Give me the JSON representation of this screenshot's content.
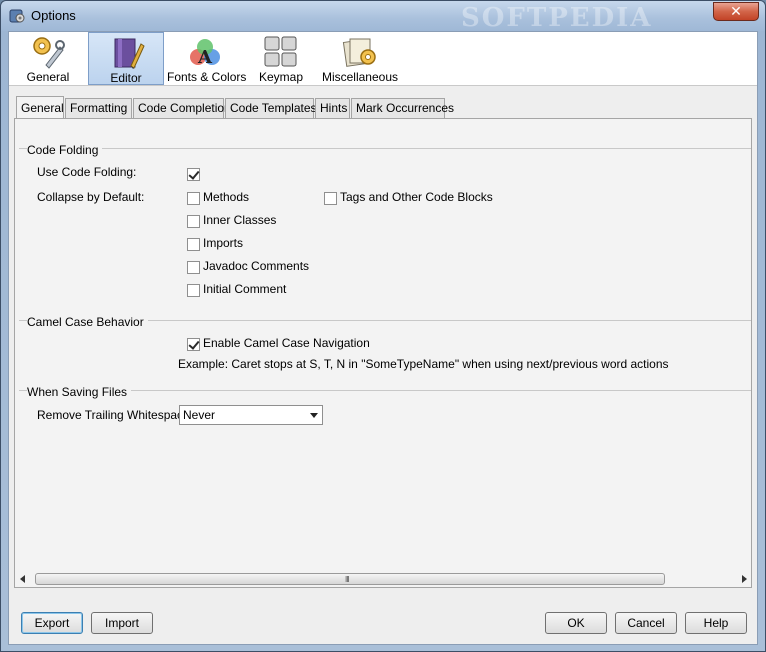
{
  "window": {
    "title": "Options",
    "watermark": "SOFTPEDIA",
    "close_glyph": "✕"
  },
  "categories": [
    {
      "label": "General",
      "icon": "gear-wrench-icon",
      "selected": false
    },
    {
      "label": "Editor",
      "icon": "editor-icon",
      "selected": true
    },
    {
      "label": "Fonts & Colors",
      "icon": "fonts-colors-icon",
      "selected": false
    },
    {
      "label": "Keymap",
      "icon": "keymap-icon",
      "selected": false
    },
    {
      "label": "Miscellaneous",
      "icon": "miscellaneous-icon",
      "selected": false
    }
  ],
  "tabs": [
    {
      "label": "General",
      "active": true
    },
    {
      "label": "Formatting",
      "active": false
    },
    {
      "label": "Code Completion",
      "active": false
    },
    {
      "label": "Code Templates",
      "active": false
    },
    {
      "label": "Hints",
      "active": false
    },
    {
      "label": "Mark Occurrences",
      "active": false
    }
  ],
  "code_folding": {
    "title": "Code Folding",
    "use_label": "Use Code Folding:",
    "use_checked": true,
    "collapse_label": "Collapse by Default:",
    "options": [
      {
        "label": "Methods",
        "checked": false
      },
      {
        "label": "Inner Classes",
        "checked": false
      },
      {
        "label": "Imports",
        "checked": false
      },
      {
        "label": "Javadoc Comments",
        "checked": false
      },
      {
        "label": "Initial Comment",
        "checked": false
      },
      {
        "label": "Tags and Other Code Blocks",
        "checked": false
      }
    ]
  },
  "camel_case": {
    "title": "Camel Case  Behavior",
    "enable_label": "Enable Camel Case Navigation",
    "enable_checked": true,
    "example": "Example: Caret stops at S, T, N in \"SomeTypeName\" when using next/previous word actions"
  },
  "saving": {
    "title": "When Saving Files",
    "trailing_label": "Remove Trailing Whitespace",
    "trailing_value": "Never"
  },
  "buttons": {
    "export": "Export",
    "import": "Import",
    "ok": "OK",
    "cancel": "Cancel",
    "help": "Help"
  },
  "scrollbar_grip": "III"
}
